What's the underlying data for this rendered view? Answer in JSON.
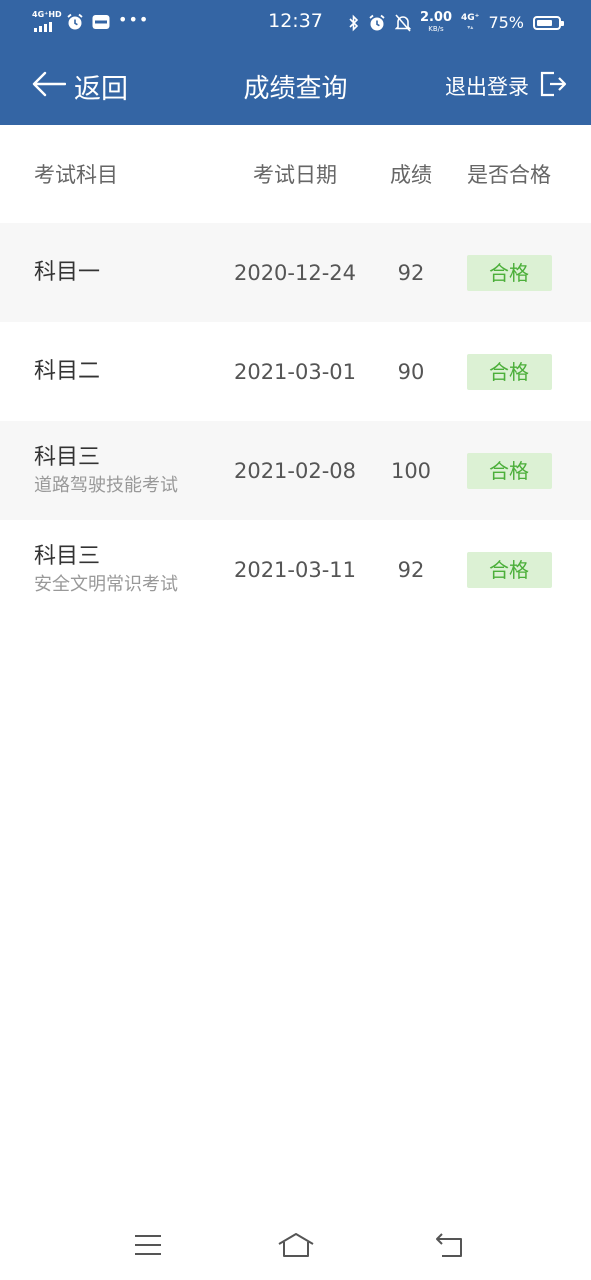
{
  "status_bar": {
    "network_label": "4G⁺HD",
    "time": "12:37",
    "speed_value": "2.00",
    "speed_unit": "KB/s",
    "net_type": "4G⁺",
    "battery": "75%",
    "battery_level": 0.75
  },
  "header": {
    "back_label": "返回",
    "title": "成绩查询",
    "logout_label": "退出登录"
  },
  "table": {
    "columns": {
      "subject": "考试科目",
      "date": "考试日期",
      "score": "成绩",
      "pass": "是否合格"
    },
    "rows": [
      {
        "subject": "科目一",
        "sub": "",
        "date": "2020-12-24",
        "score": "92",
        "pass": "合格"
      },
      {
        "subject": "科目二",
        "sub": "",
        "date": "2021-03-01",
        "score": "90",
        "pass": "合格"
      },
      {
        "subject": "科目三",
        "sub": "道路驾驶技能考试",
        "date": "2021-02-08",
        "score": "100",
        "pass": "合格"
      },
      {
        "subject": "科目三",
        "sub": "安全文明常识考试",
        "date": "2021-03-11",
        "score": "92",
        "pass": "合格"
      }
    ]
  },
  "colors": {
    "header_bg": "#3465a4",
    "pass_badge_bg": "#dcf1d4",
    "pass_badge_text": "#4caf3a",
    "alt_row_bg": "#f7f7f7"
  },
  "icons": {
    "back": "arrow-left-icon",
    "logout": "logout-icon",
    "nav_menu": "menu-icon",
    "nav_home": "home-icon",
    "nav_back": "return-icon"
  }
}
